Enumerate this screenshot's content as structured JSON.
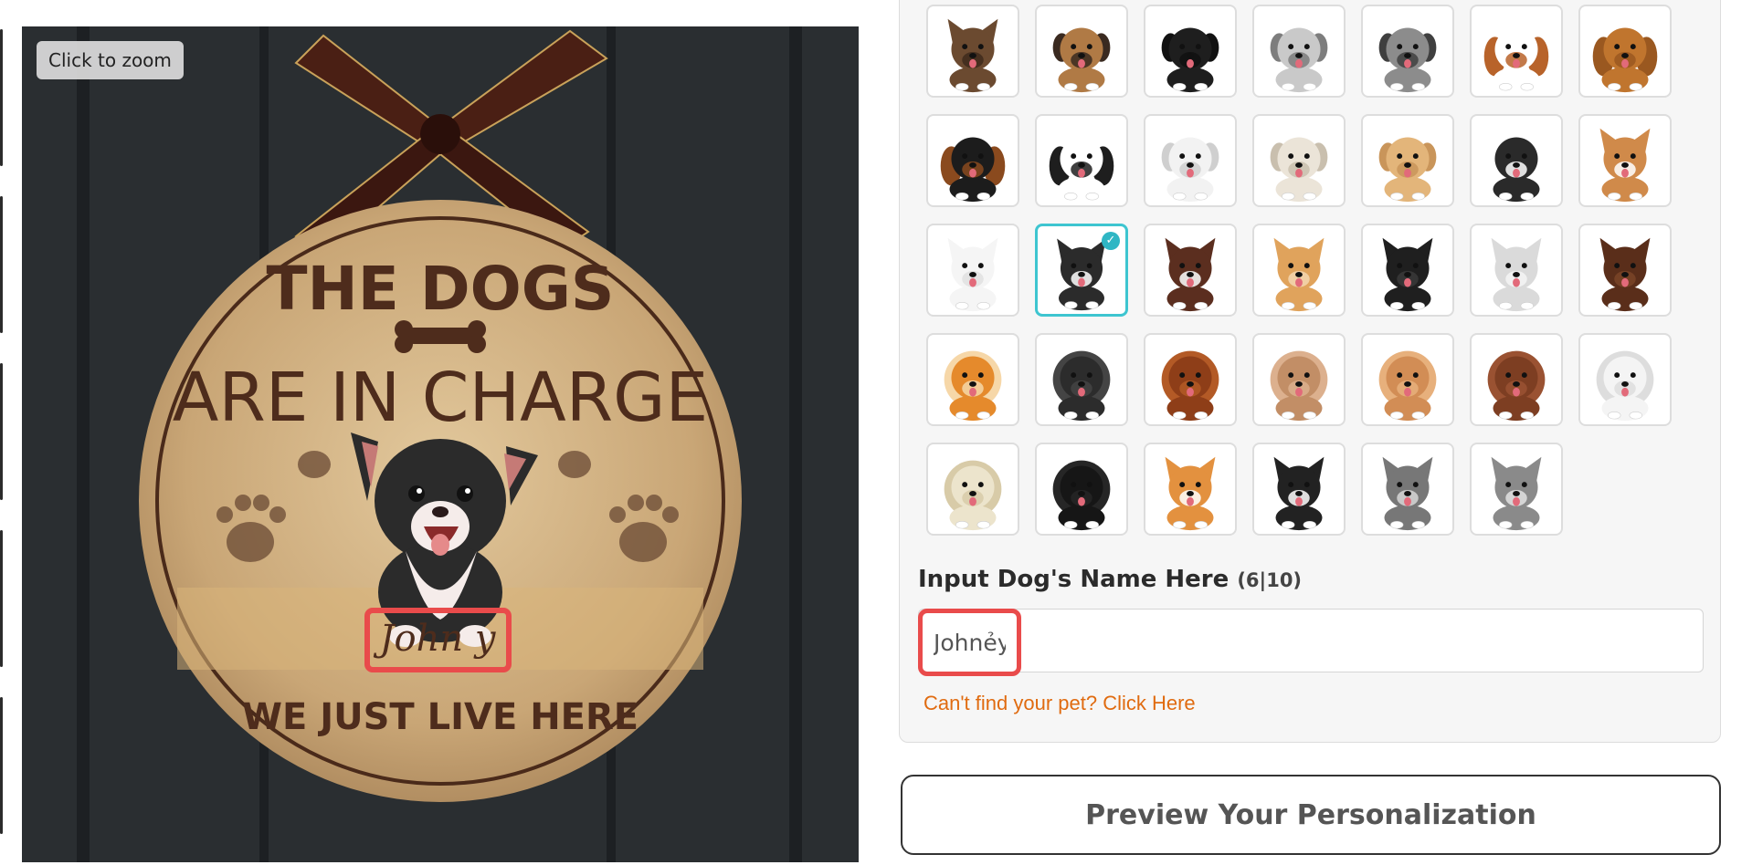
{
  "product_image": {
    "zoom_hint": "Click to zoom",
    "sign_title_line1": "THE DOGS",
    "sign_title_line2": "ARE IN CHARGE",
    "sign_footer": "WE JUST LIVE HERE",
    "sign_name": "John  y"
  },
  "breed_grid": {
    "selected_index": 15,
    "tiles": [
      {
        "fur": "#6b4a30",
        "accent": "#3e2a1c",
        "ears": "up"
      },
      {
        "fur": "#b07a45",
        "accent": "#3a2a20",
        "ears": "drop"
      },
      {
        "fur": "#1e1e1e",
        "accent": "#111111",
        "ears": "drop"
      },
      {
        "fur": "#c9c9c9",
        "accent": "#7d7d7d",
        "ears": "drop"
      },
      {
        "fur": "#8c8c8c",
        "accent": "#3f3f3f",
        "ears": "drop"
      },
      {
        "fur": "#ffffff",
        "accent": "#b8632a",
        "ears": "long"
      },
      {
        "fur": "#c0752e",
        "accent": "#9a5820",
        "ears": "long"
      },
      {
        "fur": "#1c1c1c",
        "accent": "#8a4a1e",
        "ears": "long"
      },
      {
        "fur": "#ffffff",
        "accent": "#1e1e1e",
        "ears": "long"
      },
      {
        "fur": "#f2f2f2",
        "accent": "#cfcfcf",
        "ears": "drop"
      },
      {
        "fur": "#ebe4d8",
        "accent": "#c9bfae",
        "ears": "drop"
      },
      {
        "fur": "#e3b57a",
        "accent": "#c9955a",
        "ears": "drop"
      },
      {
        "fur": "#2a2a2a",
        "accent": "#ffffff",
        "ears": "drop"
      },
      {
        "fur": "#d08a4a",
        "accent": "#ffffff",
        "ears": "up"
      },
      {
        "fur": "#f5f5f5",
        "accent": "#e0e0e0",
        "ears": "up"
      },
      {
        "fur": "#2b2b2b",
        "accent": "#ffffff",
        "ears": "up"
      },
      {
        "fur": "#5b2e1f",
        "accent": "#ffffff",
        "ears": "up"
      },
      {
        "fur": "#e0a35c",
        "accent": "#f3d7b0",
        "ears": "up"
      },
      {
        "fur": "#1f1f1f",
        "accent": "#3a3a3a",
        "ears": "up"
      },
      {
        "fur": "#dadada",
        "accent": "#f5f5f5",
        "ears": "up"
      },
      {
        "fur": "#5a2e1a",
        "accent": "#7a4428",
        "ears": "up"
      },
      {
        "fur": "#e58a2c",
        "accent": "#f6d7a8",
        "ears": "fluff"
      },
      {
        "fur": "#2c2c2c",
        "accent": "#444444",
        "ears": "fluff"
      },
      {
        "fur": "#8e3e18",
        "accent": "#b35a26",
        "ears": "fluff"
      },
      {
        "fur": "#c28e66",
        "accent": "#dcb08e",
        "ears": "fluff"
      },
      {
        "fur": "#d28d55",
        "accent": "#e7b07c",
        "ears": "fluff"
      },
      {
        "fur": "#7d3e22",
        "accent": "#9a5232",
        "ears": "fluff"
      },
      {
        "fur": "#f4f4f4",
        "accent": "#dddddd",
        "ears": "fluff"
      },
      {
        "fur": "#ece4cc",
        "accent": "#d8cba8",
        "ears": "fluff"
      },
      {
        "fur": "#161616",
        "accent": "#262626",
        "ears": "fluff"
      },
      {
        "fur": "#e3913f",
        "accent": "#ffffff",
        "ears": "up"
      },
      {
        "fur": "#222222",
        "accent": "#ffffff",
        "ears": "up"
      },
      {
        "fur": "#777777",
        "accent": "#d6d6d6",
        "ears": "up"
      },
      {
        "fur": "#8a8a8a",
        "accent": "#e2e2e2",
        "ears": "up"
      }
    ]
  },
  "name_field": {
    "label": "Input Dog's Name Here",
    "counter": "(6|10)",
    "value": "Johnẻy"
  },
  "help_link": "Can't find your pet? Click Here",
  "preview_button": "Preview Your Personalization",
  "colors": {
    "selected_border": "#3ec5d0",
    "highlight_red": "#e94b4b",
    "link_orange": "#e06b10"
  }
}
